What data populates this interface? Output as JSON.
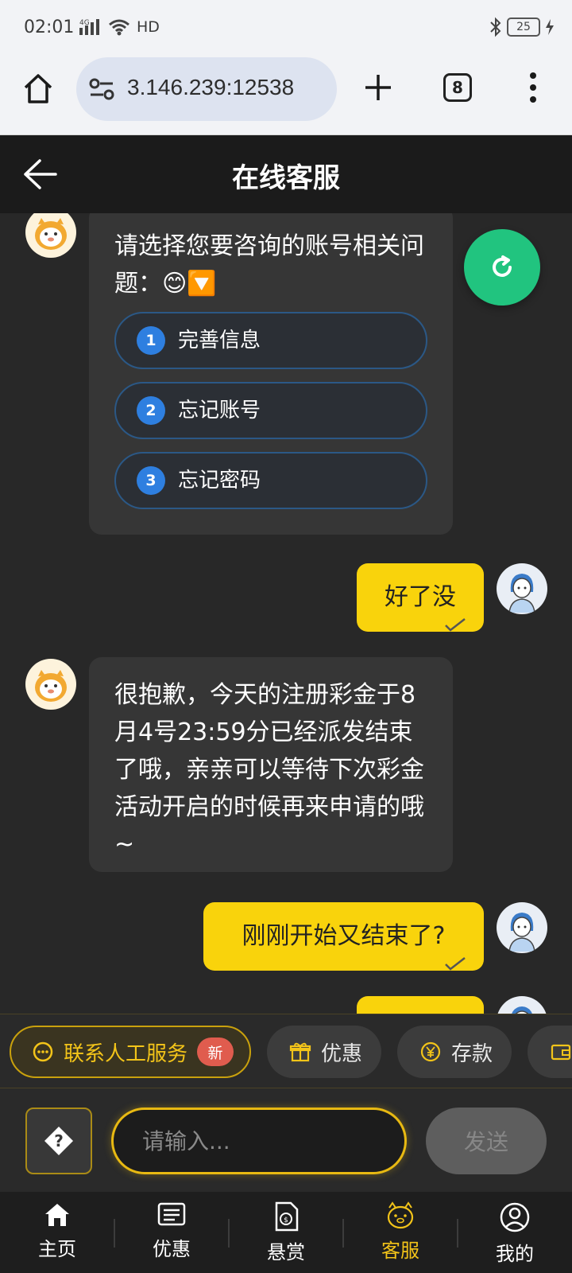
{
  "status": {
    "time": "02:01",
    "network": "4G",
    "hd": "HD",
    "battery": "25"
  },
  "browser": {
    "url": "3.146.239:12538",
    "tab_count": "8"
  },
  "header": {
    "title": "在线客服"
  },
  "chat": {
    "menu_prompt": "请选择您要咨询的账号相关问题：😊🔽",
    "options": [
      {
        "num": "1",
        "label": "完善信息"
      },
      {
        "num": "2",
        "label": "忘记账号"
      },
      {
        "num": "3",
        "label": "忘记密码"
      }
    ],
    "user_msg_1": "好了没",
    "bot_reply": "很抱歉，今天的注册彩金于8月4号23:59分已经派发结束了哦，亲亲可以等待下次彩金活动开启的时候再来申请的哦~",
    "user_msg_2": "刚刚开始又结束了?"
  },
  "quick_actions": {
    "human_service": "联系人工服务",
    "new_badge": "新",
    "promo": "优惠",
    "deposit": "存款"
  },
  "input": {
    "placeholder": "请输入...",
    "send_label": "发送"
  },
  "nav": [
    {
      "label": "主页",
      "icon": "home-icon"
    },
    {
      "label": "优惠",
      "icon": "list-icon"
    },
    {
      "label": "悬赏",
      "icon": "document-coin-icon"
    },
    {
      "label": "客服",
      "icon": "mascot-icon"
    },
    {
      "label": "我的",
      "icon": "profile-icon"
    }
  ],
  "colors": {
    "accent": "#f3c419",
    "user_bubble": "#f9d30c",
    "refresh": "#21c47f",
    "option_num": "#2e7fe0"
  }
}
